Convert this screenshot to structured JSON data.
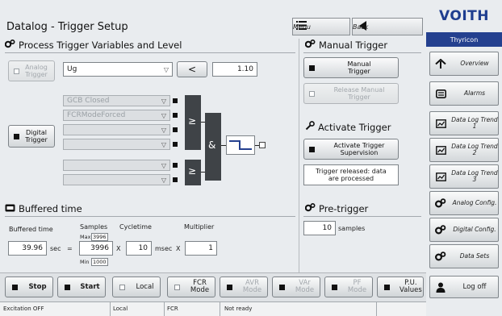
{
  "header": {
    "title": "Datalog - Trigger Setup",
    "menu_label": "Menu",
    "back_label": "Back"
  },
  "sidebar": {
    "logo": "VOITH",
    "brand": "Thyricon",
    "items": [
      {
        "label": "Overview",
        "icon": "home-icon"
      },
      {
        "label": "Alarms",
        "icon": "alarm-list-icon"
      },
      {
        "label": "Data Log Trend 1",
        "icon": "trend-chart-icon"
      },
      {
        "label": "Data Log Trend 2",
        "icon": "trend-chart-icon"
      },
      {
        "label": "Data Log Trend 3",
        "icon": "trend-chart-icon"
      },
      {
        "label": "Analog Config.",
        "icon": "gears-icon"
      },
      {
        "label": "Digital Config.",
        "icon": "gears-icon"
      },
      {
        "label": "Data Sets",
        "icon": "gears-icon"
      },
      {
        "label": "Log off",
        "icon": "user-icon"
      }
    ]
  },
  "process_trigger": {
    "heading": "Process Trigger Variables and Level",
    "analog_trigger_label": "Analog Trigger",
    "analog_signal": "Ug",
    "comparator": "<",
    "threshold": "1.10",
    "digital_trigger_label": "Digital Trigger",
    "and_inputs": [
      "GCB Closed",
      "FCRModeForced",
      "",
      ""
    ],
    "or_inputs": [
      "",
      ""
    ],
    "or_gate_symbol": "≥",
    "and_gate_symbol": "&"
  },
  "buffered_time": {
    "heading": "Buffered time",
    "buffered_label": "Buffered time",
    "samples_label": "Samples",
    "max_label": "Max",
    "max_value": "3996",
    "min_label": "Min",
    "min_value": "1000",
    "cycletime_label": "Cycletime",
    "multiplier_label": "Multiplier",
    "buffered_value": "39.96",
    "buffered_unit": "sec",
    "equals": "=",
    "samples_value": "3996",
    "times_1": "X",
    "cycletime_value": "10",
    "cycletime_unit": "msec",
    "times_2": "X",
    "multiplier_value": "1"
  },
  "manual_trigger": {
    "heading": "Manual Trigger",
    "manual_button": "Manual Trigger",
    "release_button": "Release Manual Trigger"
  },
  "activate_trigger": {
    "heading": "Activate Trigger",
    "supervision_button": "Activate Trigger Supervision",
    "status_text": "Trigger released: data are processed"
  },
  "pre_trigger": {
    "heading": "Pre-trigger",
    "value": "10",
    "unit": "samples"
  },
  "bottom_bar": {
    "stop": "Stop",
    "start": "Start",
    "local": "Local",
    "fcr": "FCR Mode",
    "avr": "AVR Mode",
    "var": "VAr Mode",
    "pf": "PF Mode",
    "pu": "P.U. Values"
  },
  "status_bar": {
    "excitation": "Excitation OFF",
    "local": "Local",
    "mode": "FCR",
    "ready": "Not ready"
  }
}
